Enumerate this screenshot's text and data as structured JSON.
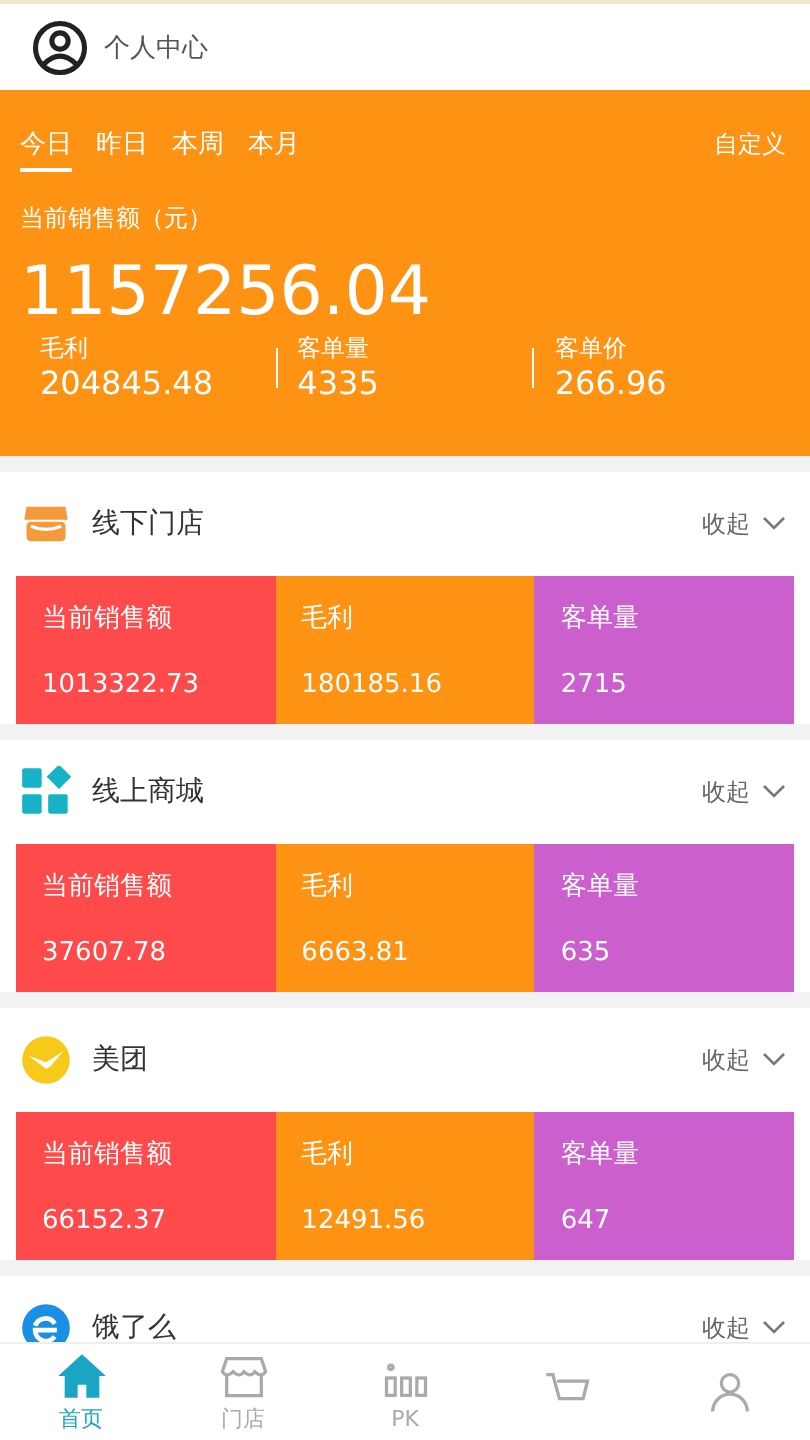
{
  "header": {
    "title": "个人中心"
  },
  "summary": {
    "tabs": [
      {
        "label": "今日",
        "selected": true
      },
      {
        "label": "昨日",
        "selected": false
      },
      {
        "label": "本周",
        "selected": false
      },
      {
        "label": "本月",
        "selected": false
      }
    ],
    "custom": "自定义",
    "total_label": "当前销售额（元）",
    "total": "1157256.04",
    "stats": [
      {
        "label": "毛利",
        "value": "204845.48"
      },
      {
        "label": "客单量",
        "value": "4335"
      },
      {
        "label": "客单价",
        "value": "266.96"
      }
    ]
  },
  "sections": [
    {
      "kind": "store",
      "title": "线下门店",
      "toggle": "收起",
      "metrics": [
        {
          "label": "当前销售额",
          "value": "1013322.73",
          "color": "#fe4a4a"
        },
        {
          "label": "毛利",
          "value": "180185.16",
          "color": "#fe9213"
        },
        {
          "label": "客单量",
          "value": "2715",
          "color": "#cb5fce"
        }
      ]
    },
    {
      "kind": "mall",
      "title": "线上商城",
      "toggle": "收起",
      "metrics": [
        {
          "label": "当前销售额",
          "value": "37607.78",
          "color": "#fe4a4a"
        },
        {
          "label": "毛利",
          "value": "6663.81",
          "color": "#fe9213"
        },
        {
          "label": "客单量",
          "value": "635",
          "color": "#cb5fce"
        }
      ]
    },
    {
      "kind": "meituan",
      "title": "美团",
      "toggle": "收起",
      "metrics": [
        {
          "label": "当前销售额",
          "value": "66152.37",
          "color": "#fe4a4a"
        },
        {
          "label": "毛利",
          "value": "12491.56",
          "color": "#fe9213"
        },
        {
          "label": "客单量",
          "value": "647",
          "color": "#cb5fce"
        }
      ]
    },
    {
      "kind": "eleme",
      "title": "饿了么",
      "toggle": "收起"
    }
  ],
  "tab_bar": [
    {
      "kind": "home",
      "label": "首页",
      "selected": true
    },
    {
      "kind": "store",
      "label": "门店",
      "selected": false
    },
    {
      "kind": "pk",
      "label": "PK",
      "selected": false
    },
    {
      "kind": "cart",
      "selected": false
    },
    {
      "kind": "person",
      "selected": false
    }
  ]
}
